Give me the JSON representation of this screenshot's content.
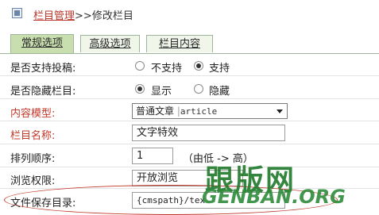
{
  "breadcrumb": {
    "parent": "栏目管理",
    "separator": ">>",
    "current": "修改栏目"
  },
  "tabs": [
    "常规选项",
    "高级选项",
    "栏目内容"
  ],
  "form": {
    "contribute": {
      "label": "是否支持投稿:",
      "options": [
        "不支持",
        "支持"
      ],
      "selected": "支持"
    },
    "hidden": {
      "label": "是否隐藏栏目:",
      "options": [
        "显示",
        "隐藏"
      ],
      "selected": "显示"
    },
    "model": {
      "label": "内容模型:",
      "value": "普通文章",
      "code": "article"
    },
    "name": {
      "label": "栏目名称:",
      "value": "文字特效"
    },
    "order": {
      "label": "排列顺序:",
      "value": "1",
      "hint": "（由低 -> 高）"
    },
    "permission": {
      "label": "浏览权限:",
      "value": "开放浏览"
    },
    "savepath": {
      "label": "文件保存目录:",
      "value": "{cmspath}/tex"
    }
  },
  "watermark": {
    "cn": "跟版网",
    "en": "GENBAN.ORG"
  },
  "colors": {
    "tab_active": "#c8deae",
    "tab_inactive": "#f1f6ea",
    "required_label": "#c0392b",
    "link": "#b8372a"
  }
}
